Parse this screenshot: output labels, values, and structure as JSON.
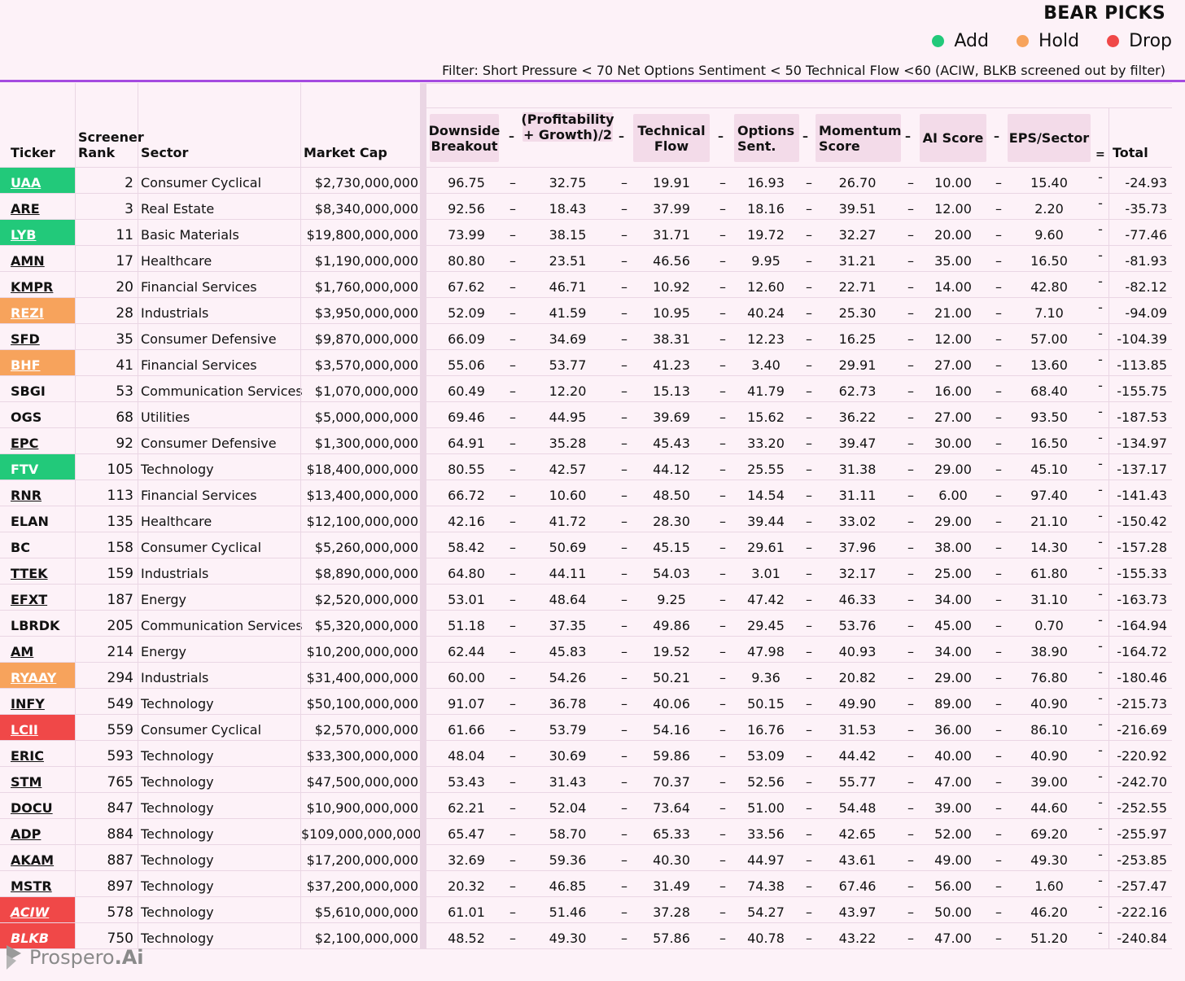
{
  "title": "BEAR PICKS",
  "legend": [
    {
      "label": "Add",
      "color": "#22c97a"
    },
    {
      "label": "Hold",
      "color": "#f7a35c"
    },
    {
      "label": "Drop",
      "color": "#f04848"
    }
  ],
  "filter_text": "Filter: Short Pressure < 70  Net Options Sentiment < 50 Technical Flow <60 (ACIW, BLKB screened out by filter)",
  "headers": {
    "ticker": "Ticker",
    "rank_line1": "Screener",
    "rank_line2": "Rank",
    "sector": "Sector",
    "market_cap": "Market Cap",
    "downside_l1": "Downside",
    "downside_l2": "Breakout",
    "profit_l1": "(Profitability",
    "profit_l2": "+ Growth)/2",
    "tech_l1": "Technical",
    "tech_l2": "Flow",
    "opt_l1": "Options",
    "opt_l2": "Sent.",
    "mom_l1": "Momentum",
    "mom_l2": "Score",
    "ai": "AI Score",
    "eps": "EPS/Sector",
    "total": "Total"
  },
  "operators": {
    "minus": "–",
    "equals": "="
  },
  "rows": [
    {
      "ticker": "UAA",
      "status": "add",
      "rank": "2",
      "sector": "Consumer Cyclical",
      "cap": "$2,730,000,000",
      "v": [
        "96.75",
        "32.75",
        "19.91",
        "16.93",
        "26.70",
        "10.00",
        "15.40"
      ],
      "total": "-24.93"
    },
    {
      "ticker": "ARE",
      "status": "",
      "rank": "3",
      "sector": "Real Estate",
      "cap": "$8,340,000,000",
      "v": [
        "92.56",
        "18.43",
        "37.99",
        "18.16",
        "39.51",
        "12.00",
        "2.20"
      ],
      "total": "-35.73"
    },
    {
      "ticker": "LYB",
      "status": "add",
      "rank": "11",
      "sector": "Basic Materials",
      "cap": "$19,800,000,000",
      "v": [
        "73.99",
        "38.15",
        "31.71",
        "19.72",
        "32.27",
        "20.00",
        "9.60"
      ],
      "total": "-77.46"
    },
    {
      "ticker": "AMN",
      "status": "",
      "rank": "17",
      "sector": "Healthcare",
      "cap": "$1,190,000,000",
      "v": [
        "80.80",
        "23.51",
        "46.56",
        "9.95",
        "31.21",
        "35.00",
        "16.50"
      ],
      "total": "-81.93"
    },
    {
      "ticker": "KMPR",
      "status": "",
      "rank": "20",
      "sector": "Financial Services",
      "cap": "$1,760,000,000",
      "v": [
        "67.62",
        "46.71",
        "10.92",
        "12.60",
        "22.71",
        "14.00",
        "42.80"
      ],
      "total": "-82.12"
    },
    {
      "ticker": "REZI",
      "status": "hold",
      "rank": "28",
      "sector": "Industrials",
      "cap": "$3,950,000,000",
      "v": [
        "52.09",
        "41.59",
        "10.95",
        "40.24",
        "25.30",
        "21.00",
        "7.10"
      ],
      "total": "-94.09"
    },
    {
      "ticker": "SFD",
      "status": "",
      "rank": "35",
      "sector": "Consumer Defensive",
      "cap": "$9,870,000,000",
      "v": [
        "66.09",
        "34.69",
        "38.31",
        "12.23",
        "16.25",
        "12.00",
        "57.00"
      ],
      "total": "-104.39"
    },
    {
      "ticker": "BHF",
      "status": "hold",
      "rank": "41",
      "sector": "Financial Services",
      "cap": "$3,570,000,000",
      "v": [
        "55.06",
        "53.77",
        "41.23",
        "3.40",
        "29.91",
        "27.00",
        "13.60"
      ],
      "total": "-113.85"
    },
    {
      "ticker": "SBGI",
      "status": "",
      "nu": true,
      "rank": "53",
      "sector": "Communication Services",
      "cap": "$1,070,000,000",
      "v": [
        "60.49",
        "12.20",
        "15.13",
        "41.79",
        "62.73",
        "16.00",
        "68.40"
      ],
      "total": "-155.75"
    },
    {
      "ticker": "OGS",
      "status": "",
      "nu": true,
      "rank": "68",
      "sector": "Utilities",
      "cap": "$5,000,000,000",
      "v": [
        "69.46",
        "44.95",
        "39.69",
        "15.62",
        "36.22",
        "27.00",
        "93.50"
      ],
      "total": "-187.53"
    },
    {
      "ticker": "EPC",
      "status": "",
      "rank": "92",
      "sector": "Consumer Defensive",
      "cap": "$1,300,000,000",
      "v": [
        "64.91",
        "35.28",
        "45.43",
        "33.20",
        "39.47",
        "30.00",
        "16.50"
      ],
      "total": "-134.97"
    },
    {
      "ticker": "FTV",
      "status": "add",
      "nu": true,
      "rank": "105",
      "sector": "Technology",
      "cap": "$18,400,000,000",
      "v": [
        "80.55",
        "42.57",
        "44.12",
        "25.55",
        "31.38",
        "29.00",
        "45.10"
      ],
      "total": "-137.17"
    },
    {
      "ticker": "RNR",
      "status": "",
      "rank": "113",
      "sector": "Financial Services",
      "cap": "$13,400,000,000",
      "v": [
        "66.72",
        "10.60",
        "48.50",
        "14.54",
        "31.11",
        "6.00",
        "97.40"
      ],
      "total": "-141.43"
    },
    {
      "ticker": "ELAN",
      "status": "",
      "nu": true,
      "rank": "135",
      "sector": "Healthcare",
      "cap": "$12,100,000,000",
      "v": [
        "42.16",
        "41.72",
        "28.30",
        "39.44",
        "33.02",
        "29.00",
        "21.10"
      ],
      "total": "-150.42"
    },
    {
      "ticker": "BC",
      "status": "",
      "nu": true,
      "rank": "158",
      "sector": "Consumer Cyclical",
      "cap": "$5,260,000,000",
      "v": [
        "58.42",
        "50.69",
        "45.15",
        "29.61",
        "37.96",
        "38.00",
        "14.30"
      ],
      "total": "-157.28"
    },
    {
      "ticker": "TTEK",
      "status": "",
      "rank": "159",
      "sector": "Industrials",
      "cap": "$8,890,000,000",
      "v": [
        "64.80",
        "44.11",
        "54.03",
        "3.01",
        "32.17",
        "25.00",
        "61.80"
      ],
      "total": "-155.33"
    },
    {
      "ticker": "EFXT",
      "status": "",
      "rank": "187",
      "sector": "Energy",
      "cap": "$2,520,000,000",
      "v": [
        "53.01",
        "48.64",
        "9.25",
        "47.42",
        "46.33",
        "34.00",
        "31.10"
      ],
      "total": "-163.73"
    },
    {
      "ticker": "LBRDK",
      "status": "",
      "nu": true,
      "rank": "205",
      "sector": "Communication Services",
      "cap": "$5,320,000,000",
      "v": [
        "51.18",
        "37.35",
        "49.86",
        "29.45",
        "53.76",
        "45.00",
        "0.70"
      ],
      "total": "-164.94"
    },
    {
      "ticker": "AM",
      "status": "",
      "rank": "214",
      "sector": "Energy",
      "cap": "$10,200,000,000",
      "v": [
        "62.44",
        "45.83",
        "19.52",
        "47.98",
        "40.93",
        "34.00",
        "38.90"
      ],
      "total": "-164.72"
    },
    {
      "ticker": "RYAAY",
      "status": "hold",
      "rank": "294",
      "sector": "Industrials",
      "cap": "$31,400,000,000",
      "v": [
        "60.00",
        "54.26",
        "50.21",
        "9.36",
        "20.82",
        "29.00",
        "76.80"
      ],
      "total": "-180.46"
    },
    {
      "ticker": "INFY",
      "status": "",
      "rank": "549",
      "sector": "Technology",
      "cap": "$50,100,000,000",
      "v": [
        "91.07",
        "36.78",
        "40.06",
        "50.15",
        "49.90",
        "89.00",
        "40.90"
      ],
      "total": "-215.73"
    },
    {
      "ticker": "LCII",
      "status": "drop",
      "rank": "559",
      "sector": "Consumer Cyclical",
      "cap": "$2,570,000,000",
      "v": [
        "61.66",
        "53.79",
        "54.16",
        "16.76",
        "31.53",
        "36.00",
        "86.10"
      ],
      "total": "-216.69"
    },
    {
      "ticker": "ERIC",
      "status": "",
      "rank": "593",
      "sector": "Technology",
      "cap": "$33,300,000,000",
      "v": [
        "48.04",
        "30.69",
        "59.86",
        "53.09",
        "44.42",
        "40.00",
        "40.90"
      ],
      "total": "-220.92"
    },
    {
      "ticker": "STM",
      "status": "",
      "rank": "765",
      "sector": "Technology",
      "cap": "$47,500,000,000",
      "v": [
        "53.43",
        "31.43",
        "70.37",
        "52.56",
        "55.77",
        "47.00",
        "39.00"
      ],
      "total": "-242.70"
    },
    {
      "ticker": "DOCU",
      "status": "",
      "rank": "847",
      "sector": "Technology",
      "cap": "$10,900,000,000",
      "v": [
        "62.21",
        "52.04",
        "73.64",
        "51.00",
        "54.48",
        "39.00",
        "44.60"
      ],
      "total": "-252.55"
    },
    {
      "ticker": "ADP",
      "status": "",
      "rank": "884",
      "sector": "Technology",
      "cap": "$109,000,000,000",
      "v": [
        "65.47",
        "58.70",
        "65.33",
        "33.56",
        "42.65",
        "52.00",
        "69.20"
      ],
      "total": "-255.97"
    },
    {
      "ticker": "AKAM",
      "status": "",
      "rank": "887",
      "sector": "Technology",
      "cap": "$17,200,000,000",
      "v": [
        "32.69",
        "59.36",
        "40.30",
        "44.97",
        "43.61",
        "49.00",
        "49.30"
      ],
      "total": "-253.85"
    },
    {
      "ticker": "MSTR",
      "status": "",
      "rank": "897",
      "sector": "Technology",
      "cap": "$37,200,000,000",
      "v": [
        "20.32",
        "46.85",
        "31.49",
        "74.38",
        "67.46",
        "56.00",
        "1.60"
      ],
      "total": "-257.47"
    },
    {
      "ticker": "ACIW",
      "status": "drop",
      "it": true,
      "rank": "578",
      "sector": "Technology",
      "cap": "$5,610,000,000",
      "v": [
        "61.01",
        "51.46",
        "37.28",
        "54.27",
        "43.97",
        "50.00",
        "46.20"
      ],
      "total": "-222.16"
    },
    {
      "ticker": "BLKB",
      "status": "drop",
      "it": true,
      "nu": true,
      "rank": "750",
      "sector": "Technology",
      "cap": "$2,100,000,000",
      "v": [
        "48.52",
        "49.30",
        "57.86",
        "40.78",
        "43.22",
        "47.00",
        "51.20"
      ],
      "total": "-240.84"
    }
  ],
  "logo": {
    "name": "Prospero",
    "suffix": ".Ai"
  }
}
